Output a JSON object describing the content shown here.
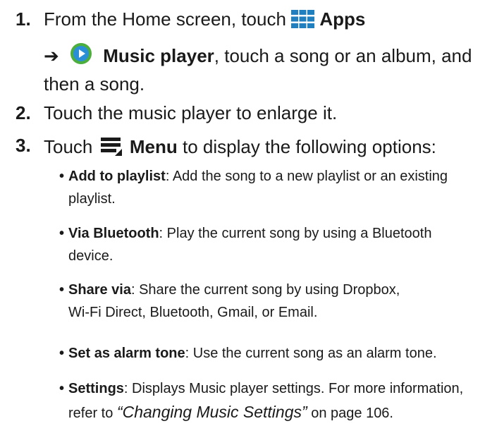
{
  "steps": [
    {
      "number": "1.",
      "line1_pre": "From the Home screen, touch",
      "line1_bold": "Apps",
      "line2_arrow": "➔",
      "line2_bold": "Music player",
      "line2_rest": ", touch a song or an album, and",
      "line3": "then a song."
    },
    {
      "number": "2.",
      "text": "Touch the music player to enlarge it."
    },
    {
      "number": "3.",
      "pre": "Touch",
      "bold": "Menu",
      "rest": "to display the following options:"
    }
  ],
  "options": [
    {
      "term": "Add to playlist",
      "desc": ": Add the song to a new playlist or an existing",
      "desc2": "playlist."
    },
    {
      "term": "Via Bluetooth",
      "desc": ": Play the current song by using a Bluetooth",
      "desc2": "device."
    },
    {
      "term": "Share via",
      "desc": ": Share the current song by using Dropbox,",
      "desc2": "Wi-Fi Direct, Bluetooth, Gmail, or Email."
    },
    {
      "term": "Set as alarm tone",
      "desc": ": Use the current song as an alarm tone."
    },
    {
      "term": "Settings",
      "desc": ": Displays Music player settings. For more information,",
      "desc2_pre": "refer to ",
      "desc2_italic": "“Changing Music Settings”",
      "desc2_post": "  on page 106."
    }
  ],
  "icons": {
    "apps": "apps-grid-icon",
    "music": "music-player-icon",
    "menu": "menu-icon"
  },
  "colors": {
    "apps_icon": "#1f7fbf",
    "music_icon_ring": "#4cae3c",
    "music_icon_center": "#2a8fd6",
    "menu_icon": "#1a1a1a",
    "text": "#1a1a1a"
  }
}
